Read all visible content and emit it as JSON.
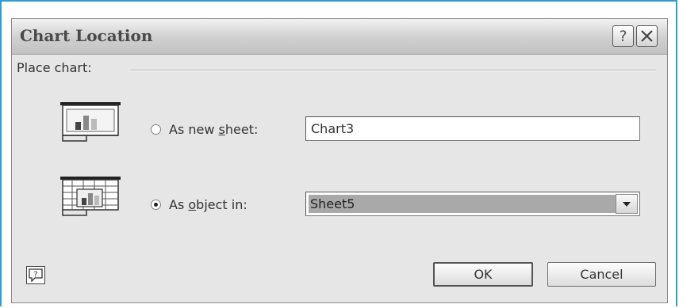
{
  "dialog": {
    "title": "Chart Location",
    "help_button": "?",
    "close_button": "✕"
  },
  "group": {
    "label": "Place chart:"
  },
  "options": {
    "new_sheet": {
      "label_pre": "As new ",
      "label_accel": "s",
      "label_post": "heet:",
      "value": "Chart3",
      "selected": false
    },
    "object_in": {
      "label_pre": "As ",
      "label_accel": "o",
      "label_post": "bject in:",
      "value": "Sheet5",
      "selected": true
    }
  },
  "buttons": {
    "ok": "OK",
    "cancel": "Cancel",
    "context_help": "?"
  },
  "icons": {
    "new_sheet": "chart-sheet-icon",
    "object_in": "embedded-chart-icon",
    "dropdown": "chevron-down-icon"
  }
}
